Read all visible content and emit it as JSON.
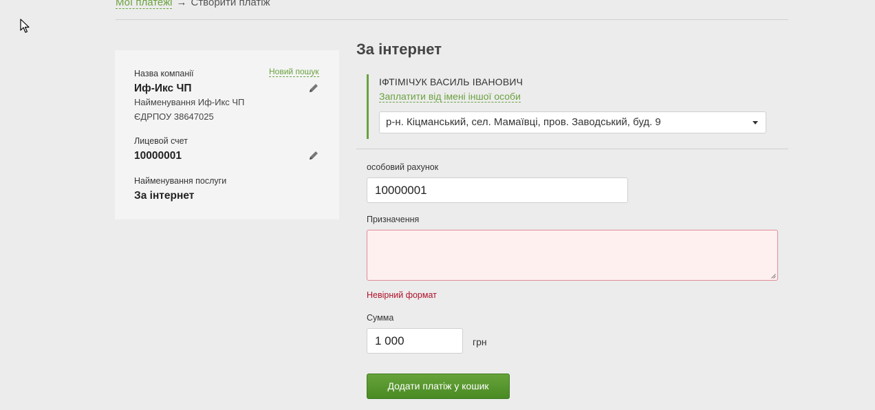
{
  "breadcrumb": {
    "link": "Мої платежі",
    "separator": "→",
    "current": "Створити платіж"
  },
  "company_card": {
    "company_label": "Назва компанії",
    "new_search": "Новий пошук",
    "company_name": "Иф-Икс ЧП",
    "company_fullname": "Найменування Иф-Икс ЧП",
    "edrpou": "ЄДРПОУ 38647025",
    "account_label": "Лицевой счет",
    "account_value": "10000001",
    "service_label": "Найменування послуги",
    "service_value": "За інтернет"
  },
  "form": {
    "title": "За інтернет",
    "payer_name": "ІФТІМІЧУК ВАСИЛЬ ІВАНОВИЧ",
    "pay_for_other": "Заплатити від імені іншої особи",
    "address": "р-н. Кіцманський, сел. Мамаївці, пров. Заводський, буд. 9",
    "account_label": "особовий рахунок",
    "account_value": "10000001",
    "purpose_label": "Призначення",
    "purpose_value": "",
    "purpose_error": "Невірний формат",
    "amount_label": "Сумма",
    "amount_value": "1 000",
    "currency": "грн",
    "submit": "Додати платіж у кошик"
  },
  "colors": {
    "accent": "#6aa23e",
    "error": "#b0102a",
    "error_bg": "#fff0f0",
    "button": "#559630"
  },
  "icons": {
    "edit": "pencil-icon",
    "dropdown": "caret-down-icon",
    "cursor": "mouse-cursor-icon",
    "resize": "resize-grip-icon"
  }
}
